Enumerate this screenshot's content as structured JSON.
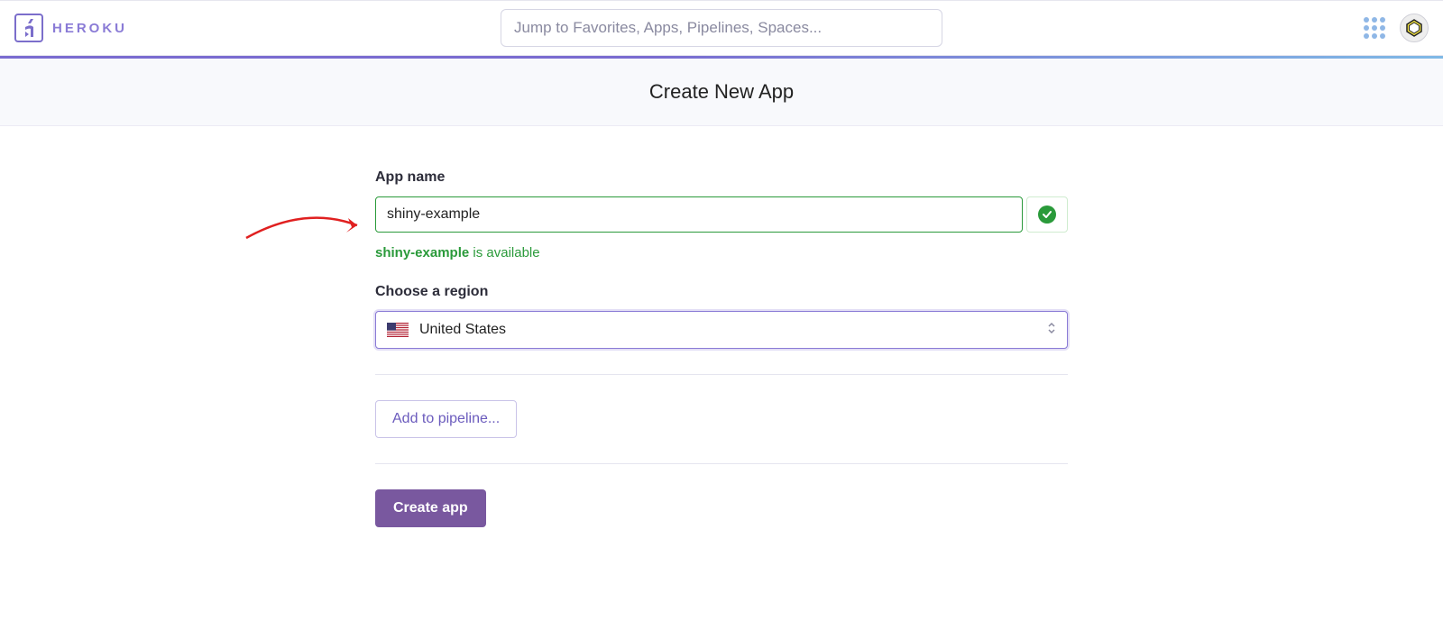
{
  "brand": {
    "name": "HEROKU"
  },
  "search": {
    "placeholder": "Jump to Favorites, Apps, Pipelines, Spaces..."
  },
  "header": {
    "title": "Create New App"
  },
  "form": {
    "app_name_label": "App name",
    "app_name_value": "shiny-example",
    "availability_name": "shiny-example",
    "availability_text": " is available",
    "region_label": "Choose a region",
    "region_value": "United States",
    "pipeline_button": "Add to pipeline...",
    "submit_button": "Create app"
  }
}
